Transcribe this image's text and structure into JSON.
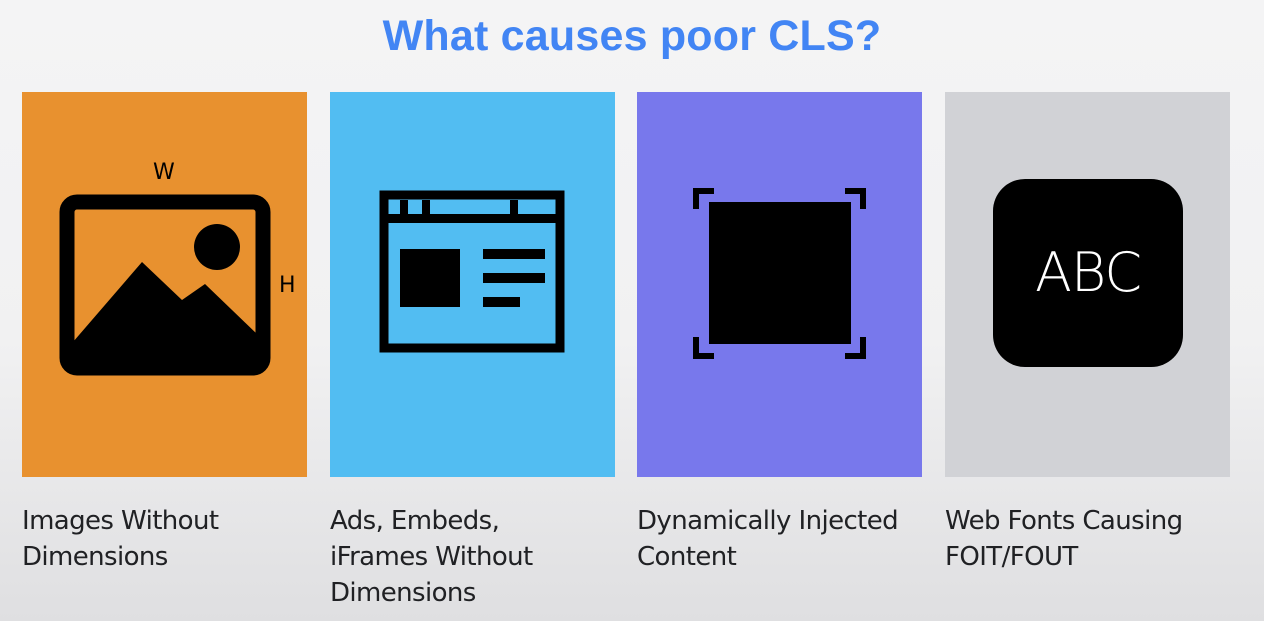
{
  "title": "What causes poor CLS?",
  "colors": {
    "title": "#4285f4",
    "card_orange": "#e8912f",
    "card_sky": "#52bdf2",
    "card_purple": "#7878ec",
    "card_gray": "#d1d2d6",
    "label": "#202124"
  },
  "cards": [
    {
      "icon": "image-dimensions-icon",
      "width_letter": "W",
      "height_letter": "H",
      "label_lines": [
        "Images Without",
        "Dimensions"
      ]
    },
    {
      "icon": "browser-window-icon",
      "label_lines": [
        "Ads, Embeds,",
        "iFrames Without",
        "Dimensions"
      ]
    },
    {
      "icon": "injected-content-icon",
      "label_lines": [
        "Dynamically Injected",
        "Content"
      ]
    },
    {
      "icon": "web-font-icon",
      "icon_text": "ABC",
      "label_lines": [
        "Web Fonts Causing",
        "FOIT/FOUT"
      ]
    }
  ]
}
